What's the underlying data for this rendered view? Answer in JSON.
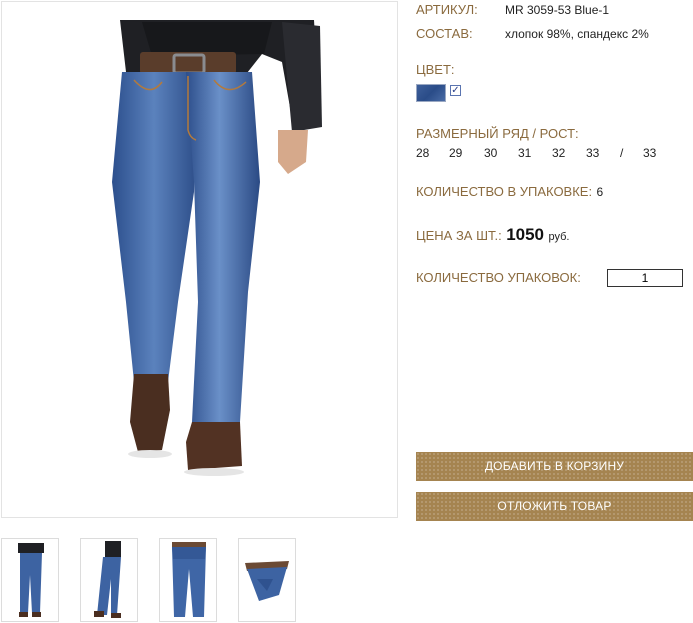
{
  "product": {
    "article_label": "АРТИКУЛ:",
    "article_value": "MR 3059-53 Blue-1",
    "composition_label": "СОСТАВ:",
    "composition_value": "хлопок 98%, спандекс 2%",
    "color_label": "ЦВЕТ:",
    "color_swatch": "#2f5290",
    "color_checkbox_mark": "✓",
    "size_label": "РАЗМЕРНЫЙ РЯД / РОСТ:",
    "sizes": [
      "28",
      "29",
      "30",
      "31",
      "32",
      "33",
      "/",
      "33"
    ],
    "pack_qty_label": "КОЛИЧЕСТВО В УПАКОВКЕ:",
    "pack_qty_value": "6",
    "price_label": "ЦЕНА ЗА ШТ.:",
    "price_value": "1050",
    "price_currency": "руб.",
    "packs_label": "КОЛИЧЕСТВО УПАКОВОК:",
    "packs_value": "1"
  },
  "actions": {
    "add_to_cart": "ДОБАВИТЬ В КОРЗИНУ",
    "postpone": "ОТЛОЖИТЬ ТОВАР"
  },
  "thumbnails": [
    "front-view",
    "side-view",
    "flat-front",
    "folded"
  ],
  "colors": {
    "label": "#8a6a3e",
    "button": "#a58450",
    "denim": "#3b5f9c"
  }
}
